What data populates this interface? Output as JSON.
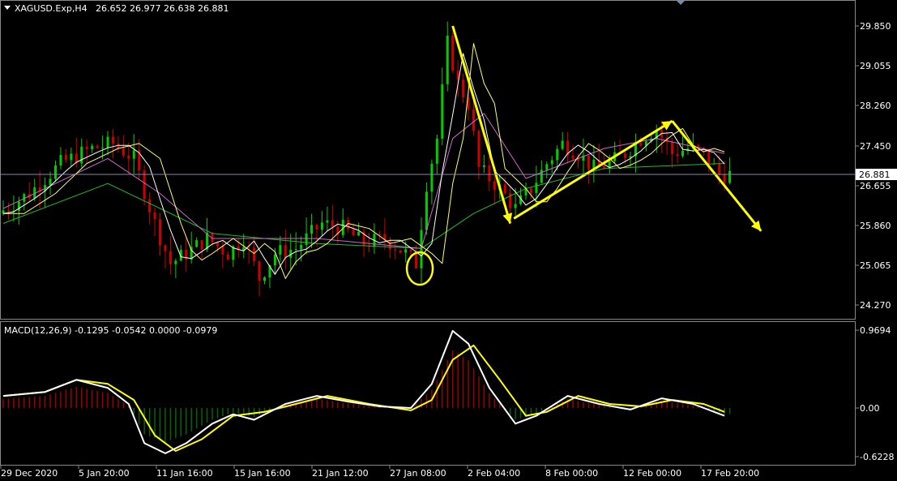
{
  "header": {
    "symbol": "XAGUSD.Exp,H4",
    "ohlc": "26.652 26.977 26.638 26.881"
  },
  "macd": {
    "label": "MACD(12,26,9) -0.1295 -0.0542 0.0000 -0.0979"
  },
  "current_price_label": "26.881",
  "colors": {
    "background": "#000000",
    "bull": "#00cc00",
    "bear": "#cc0000",
    "ma_fast": "#ffffff",
    "ma_mid": "#ffff66",
    "ma_slow": "#cc66cc",
    "ma_long": "#22bb22",
    "annotation": "#ffff00",
    "macd_line": "#ffffff",
    "signal_line": "#ffff00",
    "hist_pos": "#990000",
    "hist_neg": "#006600"
  },
  "chart_data": [
    {
      "type": "candlestick",
      "title": "XAGUSD.Exp,H4",
      "ylim": [
        24.0,
        30.2
      ],
      "y_ticks": [
        "29.850",
        "29.055",
        "28.260",
        "27.450",
        "26.655",
        "25.860",
        "25.065",
        "24.270"
      ],
      "x_ticks": [
        "29 Dec 2020",
        "5 Jan 20:00",
        "11 Jan 16:00",
        "15 Jan 16:00",
        "21 Jan 12:00",
        "27 Jan 08:00",
        "2 Feb 04:00",
        "8 Feb 00:00",
        "12 Feb 00:00",
        "17 Feb 20:00"
      ],
      "price_path": [
        [
          0,
          26.1
        ],
        [
          6,
          26.5
        ],
        [
          12,
          27.1
        ],
        [
          18,
          27.4
        ],
        [
          22,
          27.5
        ],
        [
          26,
          27.2
        ],
        [
          30,
          25.9
        ],
        [
          33,
          25.1
        ],
        [
          36,
          25.3
        ],
        [
          40,
          25.6
        ],
        [
          44,
          25.3
        ],
        [
          47,
          25.6
        ],
        [
          50,
          24.8
        ],
        [
          53,
          25.3
        ],
        [
          57,
          25.4
        ],
        [
          62,
          25.9
        ],
        [
          66,
          25.8
        ],
        [
          70,
          25.5
        ],
        [
          74,
          25.6
        ],
        [
          78,
          25.3
        ],
        [
          80,
          25.1
        ],
        [
          82,
          26.7
        ],
        [
          84,
          27.6
        ],
        [
          86,
          29.5
        ],
        [
          88,
          28.7
        ],
        [
          90,
          28.3
        ],
        [
          92,
          27.0
        ],
        [
          94,
          26.8
        ],
        [
          96,
          26.6
        ],
        [
          99,
          26.2
        ],
        [
          102,
          26.6
        ],
        [
          105,
          27.1
        ],
        [
          108,
          27.5
        ],
        [
          111,
          27.3
        ],
        [
          114,
          27.0
        ],
        [
          117,
          27.1
        ],
        [
          120,
          27.3
        ],
        [
          123,
          27.6
        ],
        [
          126,
          27.8
        ],
        [
          129,
          27.3
        ],
        [
          132,
          27.4
        ],
        [
          135,
          27.3
        ],
        [
          138,
          26.88
        ]
      ],
      "moving_averages": [
        {
          "name": "",
          "color": "#22bb22",
          "points": [
            [
              0,
              25.9
            ],
            [
              20,
              26.7
            ],
            [
              40,
              25.7
            ],
            [
              60,
              25.5
            ],
            [
              80,
              25.4
            ],
            [
              90,
              26.1
            ],
            [
              100,
              26.6
            ],
            [
              115,
              27.0
            ],
            [
              138,
              27.1
            ]
          ]
        },
        {
          "name": "",
          "color": "#cc66cc",
          "points": [
            [
              0,
              26.2
            ],
            [
              20,
              27.2
            ],
            [
              30,
              26.5
            ],
            [
              40,
              25.6
            ],
            [
              60,
              25.6
            ],
            [
              80,
              25.4
            ],
            [
              86,
              27.6
            ],
            [
              92,
              28.1
            ],
            [
              100,
              26.8
            ],
            [
              115,
              27.4
            ],
            [
              125,
              27.6
            ],
            [
              138,
              27.3
            ]
          ]
        }
      ],
      "annotations": [
        {
          "type": "circle",
          "x": 79.7,
          "y": 25.0
        },
        {
          "type": "arrow",
          "from": [
            86,
            29.85
          ],
          "to": [
            97,
            25.9
          ]
        },
        {
          "type": "arrow",
          "from": [
            97.7,
            26.0
          ],
          "to": [
            128,
            27.95
          ]
        },
        {
          "type": "arrow",
          "from": [
            128,
            27.95
          ],
          "to": [
            145,
            25.75
          ]
        }
      ]
    },
    {
      "type": "line+bar",
      "title": "MACD(12,26,9)",
      "ylim": [
        -0.7,
        1.05
      ],
      "y_ticks": [
        "0.9694",
        "0.00",
        "-0.6228"
      ],
      "macd_path": [
        [
          0,
          0.15
        ],
        [
          8,
          0.2
        ],
        [
          14,
          0.35
        ],
        [
          20,
          0.25
        ],
        [
          24,
          0.05
        ],
        [
          27,
          -0.45
        ],
        [
          31,
          -0.58
        ],
        [
          35,
          -0.45
        ],
        [
          40,
          -0.2
        ],
        [
          44,
          -0.08
        ],
        [
          48,
          -0.15
        ],
        [
          54,
          0.05
        ],
        [
          60,
          0.15
        ],
        [
          66,
          0.08
        ],
        [
          72,
          0.02
        ],
        [
          78,
          0.0
        ],
        [
          82,
          0.3
        ],
        [
          86,
          0.96
        ],
        [
          89,
          0.8
        ],
        [
          93,
          0.25
        ],
        [
          98,
          -0.2
        ],
        [
          102,
          -0.1
        ],
        [
          108,
          0.15
        ],
        [
          114,
          0.05
        ],
        [
          120,
          -0.02
        ],
        [
          126,
          0.12
        ],
        [
          132,
          0.05
        ],
        [
          138,
          -0.1
        ]
      ],
      "signal_path": [
        [
          0,
          0.15
        ],
        [
          8,
          0.2
        ],
        [
          14,
          0.35
        ],
        [
          20,
          0.3
        ],
        [
          25,
          0.1
        ],
        [
          29,
          -0.35
        ],
        [
          33,
          -0.55
        ],
        [
          38,
          -0.4
        ],
        [
          44,
          -0.1
        ],
        [
          50,
          -0.05
        ],
        [
          56,
          0.05
        ],
        [
          62,
          0.15
        ],
        [
          70,
          0.05
        ],
        [
          78,
          -0.03
        ],
        [
          82,
          0.1
        ],
        [
          86,
          0.6
        ],
        [
          90,
          0.78
        ],
        [
          95,
          0.35
        ],
        [
          100,
          -0.1
        ],
        [
          104,
          -0.05
        ],
        [
          110,
          0.15
        ],
        [
          116,
          0.05
        ],
        [
          122,
          0.02
        ],
        [
          128,
          0.1
        ],
        [
          134,
          0.05
        ],
        [
          138,
          -0.05
        ]
      ]
    }
  ]
}
